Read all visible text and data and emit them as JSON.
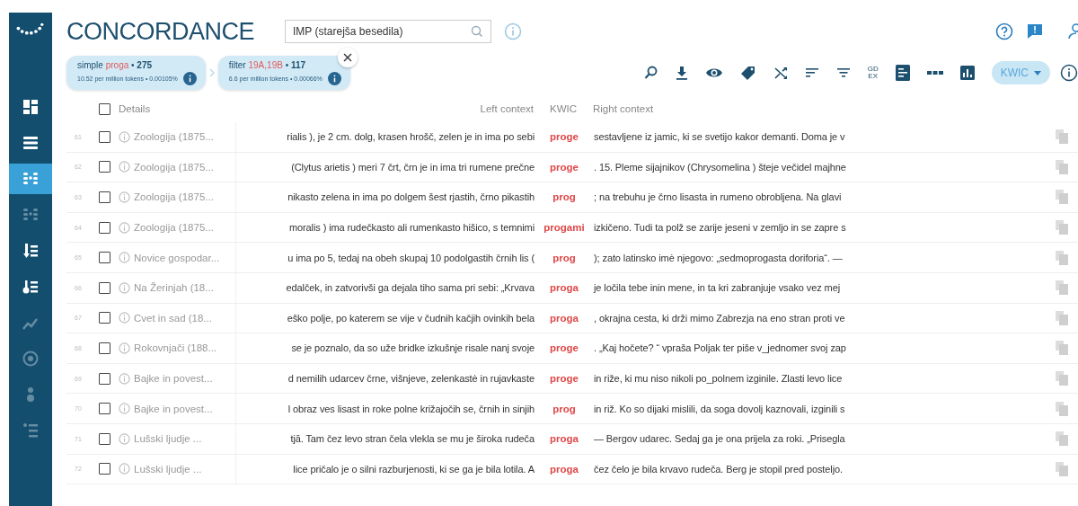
{
  "sidebar": {
    "items": [
      {
        "selected": false,
        "disabled": false
      },
      {
        "selected": false,
        "disabled": false
      },
      {
        "selected": true,
        "disabled": false
      },
      {
        "selected": false,
        "disabled": true
      },
      {
        "selected": false,
        "disabled": false
      },
      {
        "selected": false,
        "disabled": false
      },
      {
        "selected": false,
        "disabled": true
      },
      {
        "selected": false,
        "disabled": true
      },
      {
        "selected": false,
        "disabled": true
      },
      {
        "selected": false,
        "disabled": true
      }
    ]
  },
  "header": {
    "title": "CONCORDANCE",
    "corpus_field": {
      "value": "IMP (starejša besedila)"
    }
  },
  "breadcrumbs": [
    {
      "label": "simple",
      "query": "proga",
      "sep": "•",
      "count": "275",
      "detail": "10.52 per million tokens • 0.00105%",
      "closable": false
    },
    {
      "label": "filter",
      "query": "19A,19B",
      "sep": "•",
      "count": "117",
      "detail": "6.6 per million tokens • 0.00066%",
      "closable": true
    }
  ],
  "toolbar": {
    "gdex_lines": [
      "GD",
      "EX"
    ],
    "view_menu": {
      "label": "KWIC"
    }
  },
  "table": {
    "select_all": {
      "checked": false
    },
    "columns": [
      "Details",
      "Left context",
      "KWIC",
      "Right context"
    ],
    "rows": [
      {
        "num": "61",
        "checked": false,
        "title": "Zoologija (1875...",
        "left": "rialis ), je 2 cm. dolg, krasen hrošč, zelen je in ima po sebi",
        "kwic": "proge",
        "right": "sestavljene iz jamic, ki se svetijo kakor demanti. Doma je v"
      },
      {
        "num": "62",
        "checked": false,
        "title": "Zoologija (1875...",
        "left": "(Clytus arietis ) meri 7 črt, črn je in ima tri rumene prečne",
        "kwic": "proge",
        "right": ". 15. Pleme sijajnikov (Chrysomelina ) šteje večidel majhne"
      },
      {
        "num": "63",
        "checked": false,
        "title": "Zoologija (1875...",
        "left": "nikasto zelena in ima po dolgem šest rjastih, črno pikastih",
        "kwic": "prog",
        "right": "; na trebuhu je črno lisasta in rumeno obrobljena. Na glavi"
      },
      {
        "num": "64",
        "checked": false,
        "title": "Zoologija (1875...",
        "left": "moralis ) ima rudečkasto ali rumenkasto hišico, s temnimi",
        "kwic": "progami",
        "right": "izkičeno. Tudi ta polž se zarije jeseni v zemljo in se zapre s"
      },
      {
        "num": "65",
        "checked": false,
        "title": "Novice gospodar...",
        "left": "u ima po 5, tedaj na obeh skupaj 10 podolgastih črnih lis (",
        "kwic": "prog",
        "right": "); zato latinsko imė njegovo: „sedmoprogasta doriforia“. —"
      },
      {
        "num": "66",
        "checked": false,
        "title": "Na Žerinjah (18...",
        "left": "edalček, in zatvorivši ga dejala tiho sama pri sebi: „Krvava",
        "kwic": "proga",
        "right": "je ločila tebe inin mene, in ta kri zabranjuje vsako vez mej"
      },
      {
        "num": "67",
        "checked": false,
        "title": "Cvet in sad (18...",
        "left": "eško polje, po katerem se vije v čudnih kačjih ovinkih bela",
        "kwic": "proga",
        "right": ", okrajna cesta, ki drži mimo Zabrezja na eno stran proti ve"
      },
      {
        "num": "68",
        "checked": false,
        "title": "Rokovnjači (188...",
        "left": "se je poznalo, da so uže bridke izkušnje risale nanj svoje",
        "kwic": "proge",
        "right": ". „Kaj hočete? “ vpraša Poljak ter piše v_jednomer svoj zap"
      },
      {
        "num": "69",
        "checked": false,
        "title": "Bajke in povest...",
        "left": "d nemilih udarcev črne, višnjeve, zelenkastė in rujavkaste",
        "kwic": "proge",
        "right": "in riže, ki mu niso nikoli po_polnem izginile. Zlasti levo lice"
      },
      {
        "num": "70",
        "checked": false,
        "title": "Bajke in povest...",
        "left": "l obraz ves lisast in roke polne križajočih se, črnih in sinjih",
        "kwic": "prog",
        "right": "in riž. Ko so dijaki mislili, da soga dovolj kaznovali, izginili s"
      },
      {
        "num": "71",
        "checked": false,
        "title": "Lušski ljudje ...",
        "left": "tjā. Tam čez levo stran čela vlekla se mu je široka rudeča",
        "kwic": "proga",
        "right": "— Bergov udarec. Sedaj ga je ona prijela za roki. „Prisegla"
      },
      {
        "num": "72",
        "checked": false,
        "title": "Lušski ljudje ...",
        "left": "lice pričalo je o silni razburjenosti, ki se ga je bila lotila. A",
        "kwic": "proga",
        "right": "čez čelo je bila krvavo rudeča. Berg je stopil pred posteljo."
      }
    ]
  }
}
